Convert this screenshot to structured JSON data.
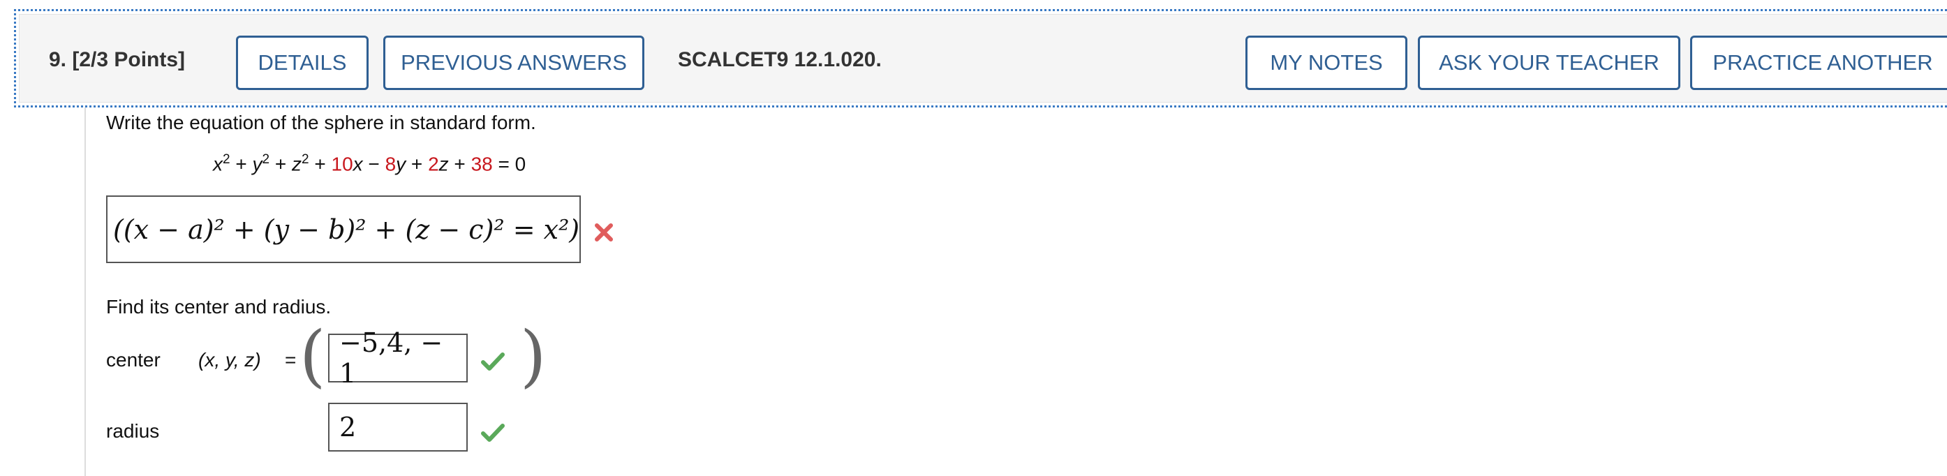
{
  "header": {
    "question_label": "9.  [2/3 Points]",
    "details_button": "DETAILS",
    "previous_answers_button": "PREVIOUS ANSWERS",
    "problem_code": "SCALCET9 12.1.020.",
    "my_notes_button": "MY NOTES",
    "ask_teacher_button": "ASK YOUR TEACHER",
    "practice_another_button": "PRACTICE ANOTHER"
  },
  "problem": {
    "instruction": "Write the equation of the sphere in standard form.",
    "equation": {
      "x2": "x",
      "y2": "y",
      "z2": "z",
      "coef_x": "10",
      "coef_y": "8",
      "coef_z": "2",
      "constant": "38",
      "rhs": "0"
    },
    "sphere_answer": "((x − a)² + (y − b)² + (z − c)² = x²)",
    "sphere_status": "incorrect",
    "find_prompt": "Find its center and radius.",
    "center_label": "center",
    "center_vars": "(x, y, z)",
    "equals": "=",
    "center_value": "−5,4, − 1",
    "center_status": "correct",
    "radius_label": "radius",
    "radius_value": "2",
    "radius_status": "correct"
  },
  "colors": {
    "accent": "#2f5f93",
    "incorrect": "#e05c5c",
    "correct": "#5aa95a",
    "highlight": "#c8181e"
  },
  "icons": {
    "incorrect": "x-mark-icon",
    "correct": "check-icon"
  }
}
